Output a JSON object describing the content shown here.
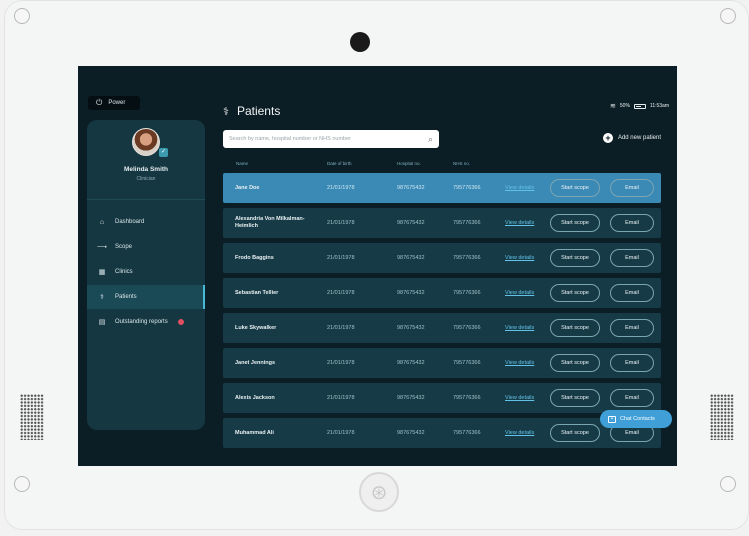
{
  "app": {
    "page_title": "Patients"
  },
  "power": {
    "label": "Power"
  },
  "status": {
    "battery": "50%",
    "time": "11:53am"
  },
  "user": {
    "name": "Melinda Smith",
    "role": "Clinician"
  },
  "nav": {
    "items": [
      {
        "label": "Dashboard",
        "icon": "home-icon"
      },
      {
        "label": "Scope",
        "icon": "scope-icon"
      },
      {
        "label": "Clinics",
        "icon": "clinic-icon"
      },
      {
        "label": "Patients",
        "icon": "patients-icon",
        "active": true
      },
      {
        "label": "Outstanding reports",
        "icon": "document-icon"
      }
    ]
  },
  "search": {
    "placeholder": "Search by name, hospital number or NHS number"
  },
  "add_patient": {
    "label": "Add new patient"
  },
  "table": {
    "headers": {
      "name": "Name",
      "dob": "Date of birth",
      "hospital": "Hospital no.",
      "nhs": "NHS no."
    },
    "rows": [
      {
        "name": "Jane Doe",
        "dob": "21/01/1978",
        "hospital": "987675432",
        "nhs": "795776366",
        "view": "View details",
        "scope": "Start scope",
        "email": "Email"
      },
      {
        "name": "Alexandria Von Milkalman-Heimlich",
        "dob": "21/01/1978",
        "hospital": "987675432",
        "nhs": "795776366",
        "view": "View details",
        "scope": "Start scope",
        "email": "Email"
      },
      {
        "name": "Frodo Baggins",
        "dob": "21/01/1978",
        "hospital": "987675432",
        "nhs": "795776366",
        "view": "View details",
        "scope": "Start scope",
        "email": "Email"
      },
      {
        "name": "Sebastian Tellier",
        "dob": "21/01/1978",
        "hospital": "987675432",
        "nhs": "795776366",
        "view": "View details",
        "scope": "Start scope",
        "email": "Email"
      },
      {
        "name": "Luke Skywalker",
        "dob": "21/01/1978",
        "hospital": "987675432",
        "nhs": "795776366",
        "view": "View details",
        "scope": "Start scope",
        "email": "Email"
      },
      {
        "name": "Janet Jennings",
        "dob": "21/01/1978",
        "hospital": "987675432",
        "nhs": "795776366",
        "view": "View details",
        "scope": "Start scope",
        "email": "Email"
      },
      {
        "name": "Alexis Jackson",
        "dob": "21/01/1978",
        "hospital": "987675432",
        "nhs": "795776366",
        "view": "View details",
        "scope": "Start scope",
        "email": "Email"
      },
      {
        "name": "Muhammad Ali",
        "dob": "21/01/1978",
        "hospital": "987675432",
        "nhs": "795776366",
        "view": "View details",
        "scope": "Start scope",
        "email": "Email"
      }
    ]
  },
  "chat": {
    "label": "Chat Contacts"
  },
  "colors": {
    "screen_bg": "#0c1e25",
    "sidebar_bg": "#143741",
    "row_bg": "#163b47",
    "selected_row": "#3b8ab6",
    "accent": "#3f9fd6",
    "link": "#62c1e6",
    "badge": "#e04f5f"
  }
}
